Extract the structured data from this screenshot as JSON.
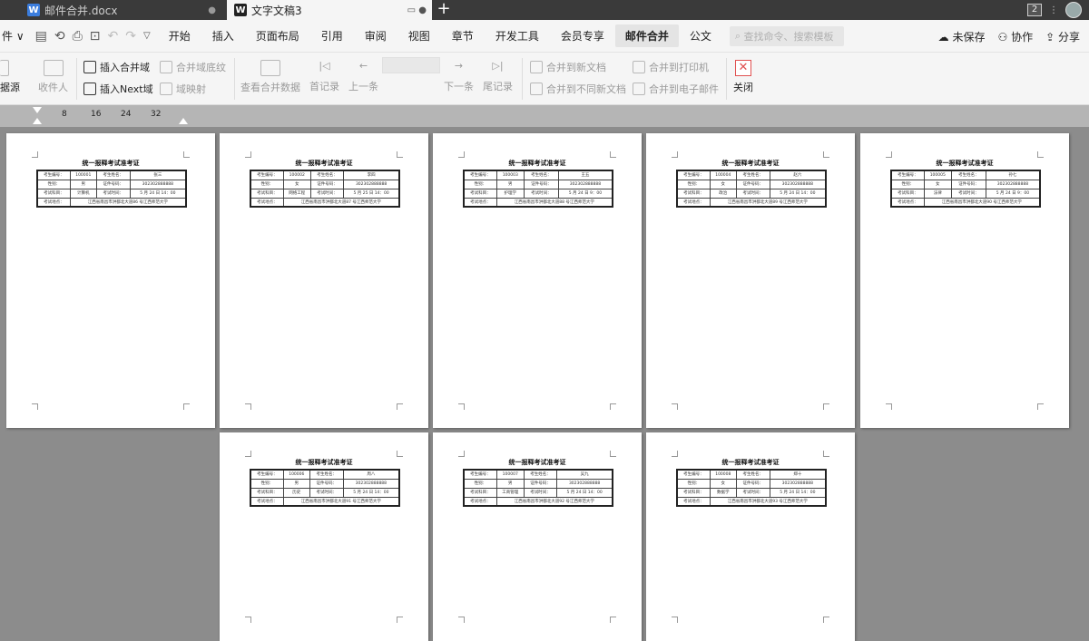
{
  "tabs": [
    {
      "label": "邮件合并.docx"
    },
    {
      "label": "文字文稿3"
    }
  ],
  "window": {
    "badge": "2"
  },
  "menu": {
    "file": "件",
    "items": [
      "开始",
      "插入",
      "页面布局",
      "引用",
      "审阅",
      "视图",
      "章节",
      "开发工具",
      "会员专享",
      "邮件合并",
      "公文"
    ],
    "search_placeholder": "查找命令、搜索模板",
    "unsaved": "未保存",
    "collab": "协作",
    "share": "分享"
  },
  "ribbon": {
    "datasource": "据源",
    "recipients": "收件人",
    "insert_merge_field": "插入合并域",
    "insert_next": "插入Next域",
    "merge_shading": "合并域底纹",
    "field_mapping": "域映射",
    "view_merged": "查看合并数据",
    "first": "首记录",
    "prev": "上一条",
    "record_value": "",
    "next": "下一条",
    "last": "尾记录",
    "to_new_doc": "合并到新文档",
    "to_diff_docs": "合并到不同新文档",
    "to_printer": "合并到打印机",
    "to_email": "合并到电子邮件",
    "close": "关闭"
  },
  "ruler": {
    "ticks": [
      "8",
      "16",
      "24",
      "32"
    ]
  },
  "document": {
    "cert_title": "统一报释考试准考证",
    "labels": {
      "exam_no": "考生编号：",
      "name": "考生姓名：",
      "gender": "性别：",
      "id": "证件号码：",
      "subject": "考试科目：",
      "time": "考试时间：",
      "place": "考试地点："
    },
    "pages": [
      {
        "no": "100001",
        "name": "张三",
        "gender": "男",
        "id": "302302888888",
        "subject": "计算机",
        "time": "5 月 24 日 14：00",
        "place": "江西省南昌市洪都北大道86 号江西师范大学"
      },
      {
        "no": "100002",
        "name": "李四",
        "gender": "女",
        "id": "302302888888",
        "subject": "网络工程",
        "time": "5 月 25 日 14：00",
        "place": "江西省南昌市洪都北大道87 号江西师范大学"
      },
      {
        "no": "100003",
        "name": "王五",
        "gender": "男",
        "id": "302302888888",
        "subject": "护理学",
        "time": "5 月 24 日 9：00",
        "place": "江西省南昌市洪都北大道88 号江西师范大学"
      },
      {
        "no": "100004",
        "name": "赵六",
        "gender": "女",
        "id": "302302888888",
        "subject": "政治",
        "time": "5 月 24 日 14：00",
        "place": "江西省南昌市洪都北大道89 号江西师范大学"
      },
      {
        "no": "100005",
        "name": "孙七",
        "gender": "女",
        "id": "302302888888",
        "subject": "法律",
        "time": "5 月 24 日 9：00",
        "place": "江西省南昌市洪都北大道90 号江西师范大学"
      },
      {
        "no": "100006",
        "name": "周八",
        "gender": "男",
        "id": "302302888888",
        "subject": "历史",
        "time": "5 月 24 日 14：00",
        "place": "江西省南昌市洪都北大道91 号江西师范大学"
      },
      {
        "no": "100007",
        "name": "吴九",
        "gender": "男",
        "id": "302302888888",
        "subject": "工商管理",
        "time": "5 月 24 日 14：00",
        "place": "江西省南昌市洪都北大道92 号江西师范大学"
      },
      {
        "no": "100008",
        "name": "郑十",
        "gender": "女",
        "id": "302302888888",
        "subject": "数据学",
        "time": "5 月 24 日 14：00",
        "place": "江西省南昌市洪都北大道93 号江西师范大学"
      }
    ]
  }
}
